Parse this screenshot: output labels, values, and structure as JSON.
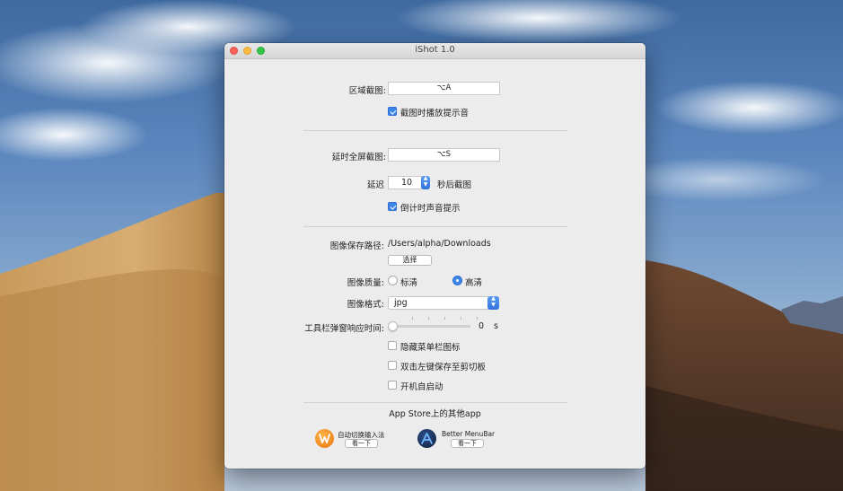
{
  "window": {
    "title": "iShot 1.0"
  },
  "region_capture": {
    "label": "区域截图:",
    "shortcut": "⌥A"
  },
  "play_sound": {
    "label": "截图时播放提示音",
    "checked": true
  },
  "delayed_capture": {
    "label": "延时全屏截图:",
    "shortcut": "⌥S"
  },
  "delay": {
    "prefix": "延迟",
    "value": "10",
    "suffix": "秒后截图",
    "stepper_up": "▲",
    "stepper_down": "▼"
  },
  "countdown_sound": {
    "label": "倒计时声音提示",
    "checked": true
  },
  "save_path": {
    "label": "图像保存路径:",
    "value": "/Users/alpha/Downloads",
    "choose_button": "选择"
  },
  "quality": {
    "label": "图像质量:",
    "options": [
      "标清",
      "高清"
    ],
    "selected": "高清"
  },
  "format": {
    "label": "图像格式:",
    "value": "jpg"
  },
  "toolbar_delay": {
    "label": "工具栏弹窗响应时间:",
    "value": "0",
    "unit": "s",
    "slider_fraction": 0
  },
  "hide_menubar_icon": {
    "label": "隐藏菜单栏图标",
    "checked": false
  },
  "double_click_copy": {
    "label": "双击左键保存至剪切板",
    "checked": false
  },
  "launch_at_login": {
    "label": "开机自启动",
    "checked": false
  },
  "other_apps": {
    "heading": "App Store上的其他app",
    "items": [
      {
        "name": "自动切换输入法",
        "button": "看一下",
        "icon": "input-switch-icon",
        "color": "#f08a1e"
      },
      {
        "name": "Better MenuBar",
        "button": "看一下",
        "icon": "better-menubar-icon",
        "color": "#1f3b6e"
      }
    ]
  },
  "colors": {
    "accent": "#3b86e8",
    "close": "#fc605c",
    "minimize": "#fdbc40",
    "maximize": "#34c84a"
  }
}
